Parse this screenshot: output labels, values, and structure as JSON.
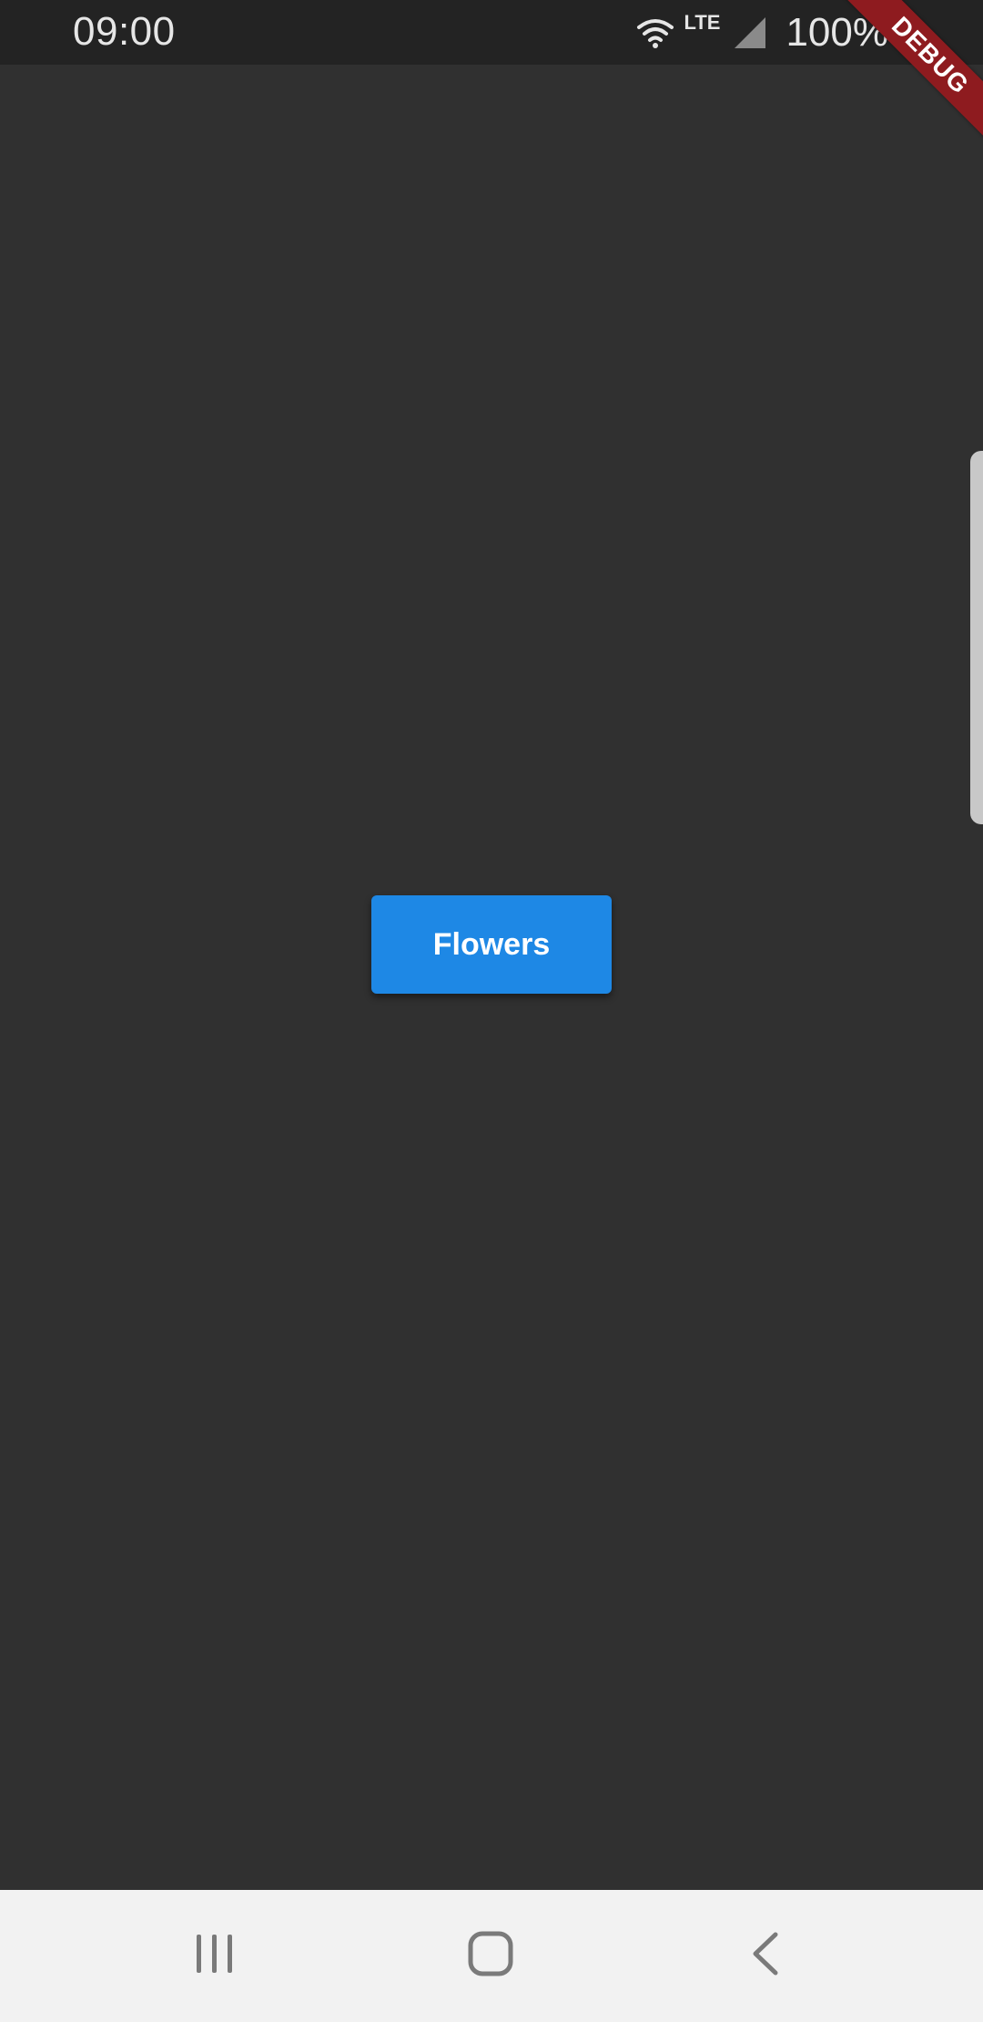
{
  "status_bar": {
    "time": "09:00",
    "network_label": "LTE",
    "battery_percent": "100%",
    "icons": [
      "wifi-icon",
      "signal-icon",
      "battery-icon"
    ]
  },
  "debug_banner": {
    "label": "DEBUG",
    "color": "#8e1b1f"
  },
  "main": {
    "button_label": "Flowers",
    "button_color": "#1e88e5",
    "background_color": "#303030"
  },
  "nav_bar": {
    "items": [
      "recents-icon",
      "home-icon",
      "back-icon"
    ]
  }
}
